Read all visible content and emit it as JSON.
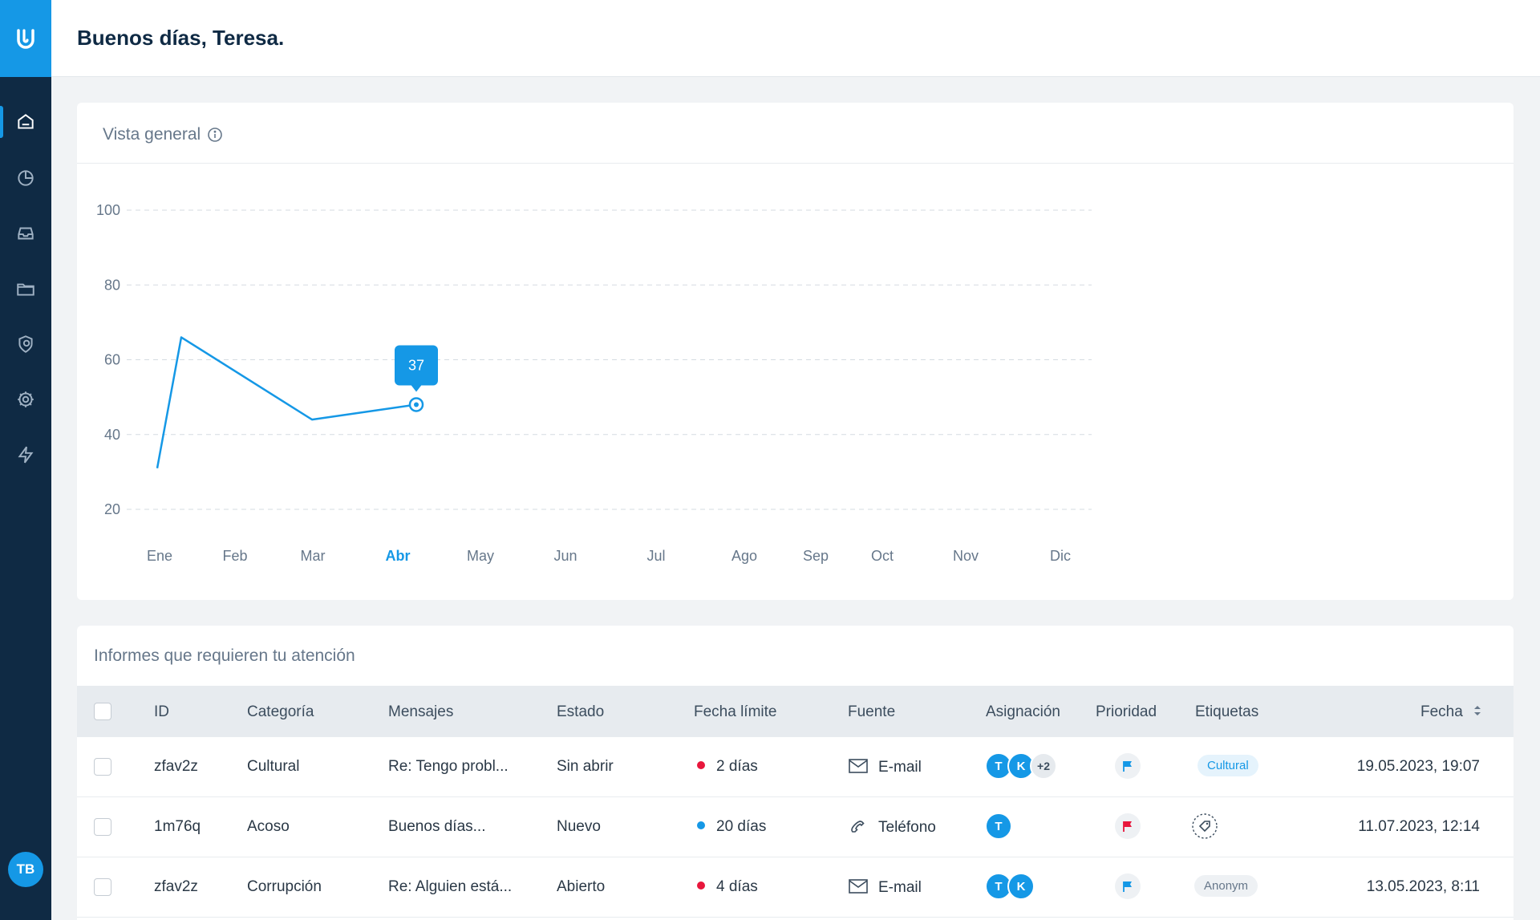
{
  "app": {
    "greeting": "Buenos días, Teresa.",
    "user_initials": "TB"
  },
  "sidebar": {
    "items": [
      {
        "icon": "home-icon",
        "active": true
      },
      {
        "icon": "pie-chart-icon",
        "active": false
      },
      {
        "icon": "inbox-icon",
        "active": false
      },
      {
        "icon": "folder-icon",
        "active": false
      },
      {
        "icon": "settings-shield-icon",
        "active": false
      },
      {
        "icon": "gear-icon",
        "active": false
      },
      {
        "icon": "lightning-icon",
        "active": false
      }
    ]
  },
  "overview": {
    "title": "Vista general",
    "tooltip_value": "37"
  },
  "chart_data": {
    "type": "line",
    "categories": [
      "Ene",
      "Feb",
      "Mar",
      "Abr",
      "May",
      "Jun",
      "Jul",
      "Ago",
      "Sep",
      "Oct",
      "Nov",
      "Dic"
    ],
    "highlighted_category": "Abr",
    "series": [
      {
        "points": [
          {
            "x": "Ene",
            "y": 31
          },
          {
            "x": "Ene-Feb",
            "y": 66
          },
          {
            "x": "Mar",
            "y": 44
          },
          {
            "x": "Abr",
            "y": 48
          }
        ]
      }
    ],
    "yticks": [
      20,
      40,
      60,
      80,
      100
    ],
    "ylim": [
      20,
      100
    ],
    "grid": true,
    "colors": {
      "line": "#1598e6",
      "grid": "#d5dbe1"
    }
  },
  "reports": {
    "title": "Informes que requieren tu atención",
    "columns": [
      "ID",
      "Categoría",
      "Mensajes",
      "Estado",
      "Fecha límite",
      "Fuente",
      "Asignación",
      "Prioridad",
      "Etiquetas",
      "Fecha"
    ],
    "rows": [
      {
        "id": "zfav2z",
        "category": "Cultural",
        "message": "Re: Tengo probl...",
        "status": "Sin abrir",
        "deadline": "2 días",
        "deadline_color": "#e8173c",
        "source": "E-mail",
        "source_icon": "mail-icon",
        "assignees": [
          "T",
          "K"
        ],
        "assignees_more": "+2",
        "priority_color": "#1598e6",
        "tag": "Cultural",
        "tag_style": "blue",
        "date": "19.05.2023, 19:07"
      },
      {
        "id": "1m76q",
        "category": "Acoso",
        "message": "Buenos días...",
        "status": "Nuevo",
        "deadline": "20 días",
        "deadline_color": "#1598e6",
        "source": "Teléfono",
        "source_icon": "phone-icon",
        "assignees": [
          "T"
        ],
        "assignees_more": "",
        "priority_color": "#e8173c",
        "tag": "",
        "tag_style": "icon",
        "date": "11.07.2023, 12:14"
      },
      {
        "id": "zfav2z",
        "category": "Corrupción",
        "message": "Re: Alguien está...",
        "status": "Abierto",
        "deadline": "4 días",
        "deadline_color": "#e8173c",
        "source": "E-mail",
        "source_icon": "mail-icon",
        "assignees": [
          "T",
          "K"
        ],
        "assignees_more": "",
        "priority_color": "#1598e6",
        "tag": "Anonym",
        "tag_style": "grey",
        "date": "13.05.2023, 8:11"
      }
    ]
  }
}
